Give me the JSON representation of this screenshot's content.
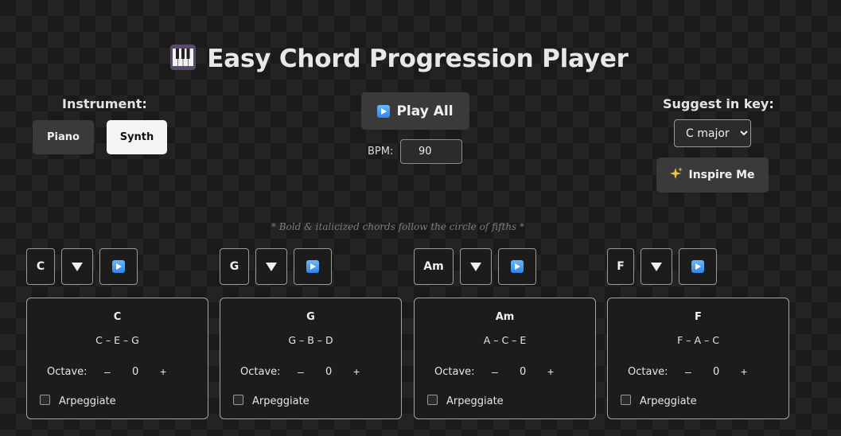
{
  "header": {
    "title": "Easy Chord Progression Player",
    "icon": "piano-keys-icon"
  },
  "instrument": {
    "label": "Instrument:",
    "options": [
      "Piano",
      "Synth"
    ],
    "selected": "Synth"
  },
  "playback": {
    "play_all_label": "Play All",
    "bpm_label": "BPM:",
    "bpm_value": "90"
  },
  "suggest": {
    "label": "Suggest in key:",
    "selected_key": "C major",
    "inspire_label": "Inspire Me",
    "inspire_icon": "sparkles-icon"
  },
  "hint": "* Bold & italicized chords follow the circle of fifths *",
  "chords": [
    {
      "symbol": "C",
      "name": "C",
      "notes": "C – E – G",
      "octave_label": "Octave:",
      "octave": "0",
      "arpeggiate_label": "Arpeggiate"
    },
    {
      "symbol": "G",
      "name": "G",
      "notes": "G – B – D",
      "octave_label": "Octave:",
      "octave": "0",
      "arpeggiate_label": "Arpeggiate"
    },
    {
      "symbol": "Am",
      "name": "Am",
      "notes": "A – C – E",
      "octave_label": "Octave:",
      "octave": "0",
      "arpeggiate_label": "Arpeggiate"
    },
    {
      "symbol": "F",
      "name": "F",
      "notes": "F – A – C",
      "octave_label": "Octave:",
      "octave": "0",
      "arpeggiate_label": "Arpeggiate"
    }
  ],
  "colors": {
    "accent_blue": "#3a8ef0",
    "button_dark": "#3a3a3a",
    "button_light": "#f4f4f4"
  }
}
